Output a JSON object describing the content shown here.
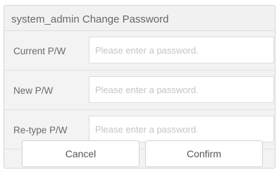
{
  "dialog": {
    "user": "system_admin",
    "title": "Change Password"
  },
  "form": {
    "fields": [
      {
        "label": "Current P/W",
        "placeholder": "Please enter a password.",
        "value": ""
      },
      {
        "label": "New P/W",
        "placeholder": "Please enter a password.",
        "value": ""
      },
      {
        "label": "Re-type P/W",
        "placeholder": "Please enter a password.",
        "value": ""
      }
    ]
  },
  "buttons": {
    "cancel_label": "Cancel",
    "confirm_label": "Confirm"
  }
}
